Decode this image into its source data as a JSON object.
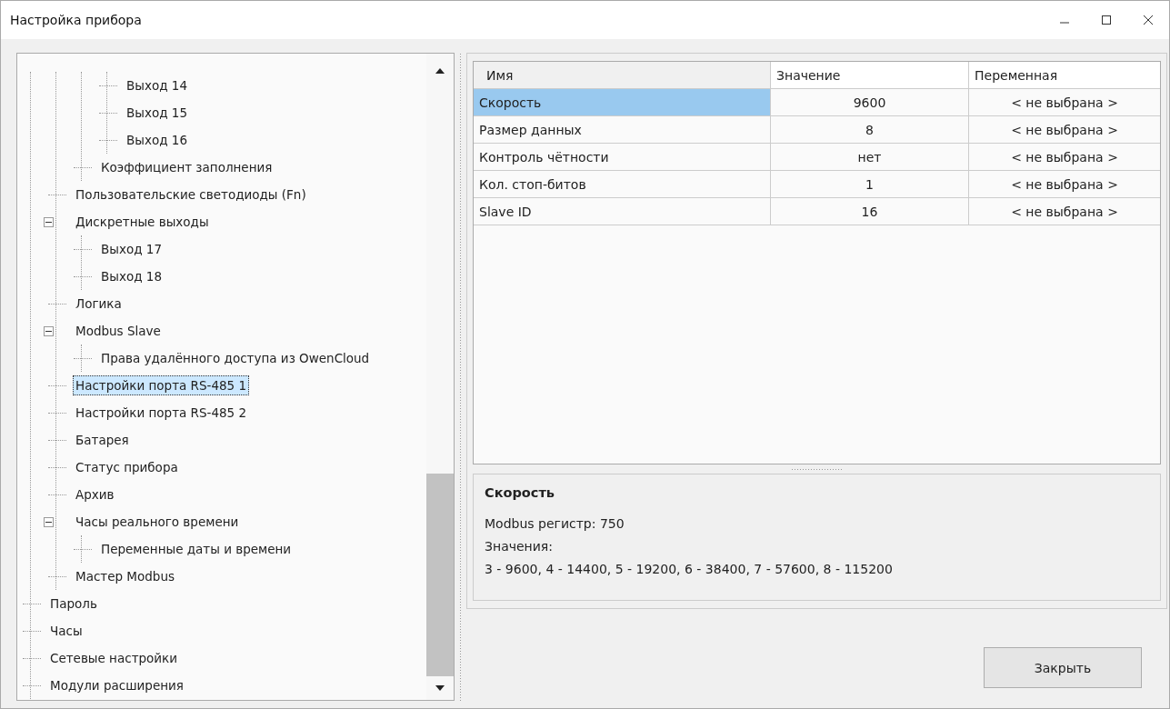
{
  "window": {
    "title": "Настройка прибора"
  },
  "tree": {
    "items": [
      {
        "children": [
          {
            "children": [
              {
                "children": [
                  {
                    "label": "Выход 14",
                    "selected": false
                  },
                  {
                    "label": "Выход 15",
                    "selected": false
                  },
                  {
                    "label": "Выход 16",
                    "selected": false
                  }
                ]
              },
              {
                "label": "Коэффициент заполнения",
                "selected": false
              }
            ]
          },
          {
            "label": "Пользовательские светодиоды (Fn)",
            "selected": false
          },
          {
            "label": "Дискретные выходы",
            "selected": false,
            "expanded": true,
            "children": [
              {
                "label": "Выход 17",
                "selected": false
              },
              {
                "label": "Выход 18",
                "selected": false
              }
            ]
          },
          {
            "label": "Логика",
            "selected": false
          },
          {
            "label": "Modbus Slave",
            "selected": false,
            "expanded": true,
            "children": [
              {
                "label": "Права удалённого доступа из OwenCloud",
                "selected": false
              }
            ]
          },
          {
            "label": "Настройки порта RS-485 1",
            "selected": true
          },
          {
            "label": "Настройки порта RS-485 2",
            "selected": false
          },
          {
            "label": "Батарея",
            "selected": false
          },
          {
            "label": "Статус прибора",
            "selected": false
          },
          {
            "label": "Архив",
            "selected": false
          },
          {
            "label": "Часы реального времени",
            "selected": false,
            "expanded": true,
            "children": [
              {
                "label": "Переменные даты и времени",
                "selected": false
              }
            ]
          },
          {
            "label": "Мастер Modbus",
            "selected": false
          }
        ]
      },
      {
        "label": "Пароль",
        "selected": false
      },
      {
        "label": "Часы",
        "selected": false
      },
      {
        "label": "Сетевые настройки",
        "selected": false
      },
      {
        "label": "Модули расширения",
        "selected": false
      }
    ]
  },
  "table": {
    "columns": [
      "Имя",
      "Значение",
      "Переменная"
    ],
    "rows": [
      {
        "name": "Скорость",
        "value": "9600",
        "variable": "< не выбрана >",
        "selected": true
      },
      {
        "name": "Размер данных",
        "value": "8",
        "variable": "< не выбрана >",
        "selected": false
      },
      {
        "name": "Контроль чётности",
        "value": "нет",
        "variable": "< не выбрана >",
        "selected": false
      },
      {
        "name": "Кол. стоп-битов",
        "value": "1",
        "variable": "< не выбрана >",
        "selected": false
      },
      {
        "name": "Slave ID",
        "value": "16",
        "variable": "< не выбрана >",
        "selected": false
      }
    ]
  },
  "details": {
    "title": "Скорость",
    "lines": [
      "Modbus регистр: 750",
      "Значения:",
      "3 - 9600, 4 - 14400, 5 - 19200, 6 - 38400, 7 - 57600, 8 - 115200"
    ]
  },
  "buttons": [
    "Закрыть"
  ]
}
